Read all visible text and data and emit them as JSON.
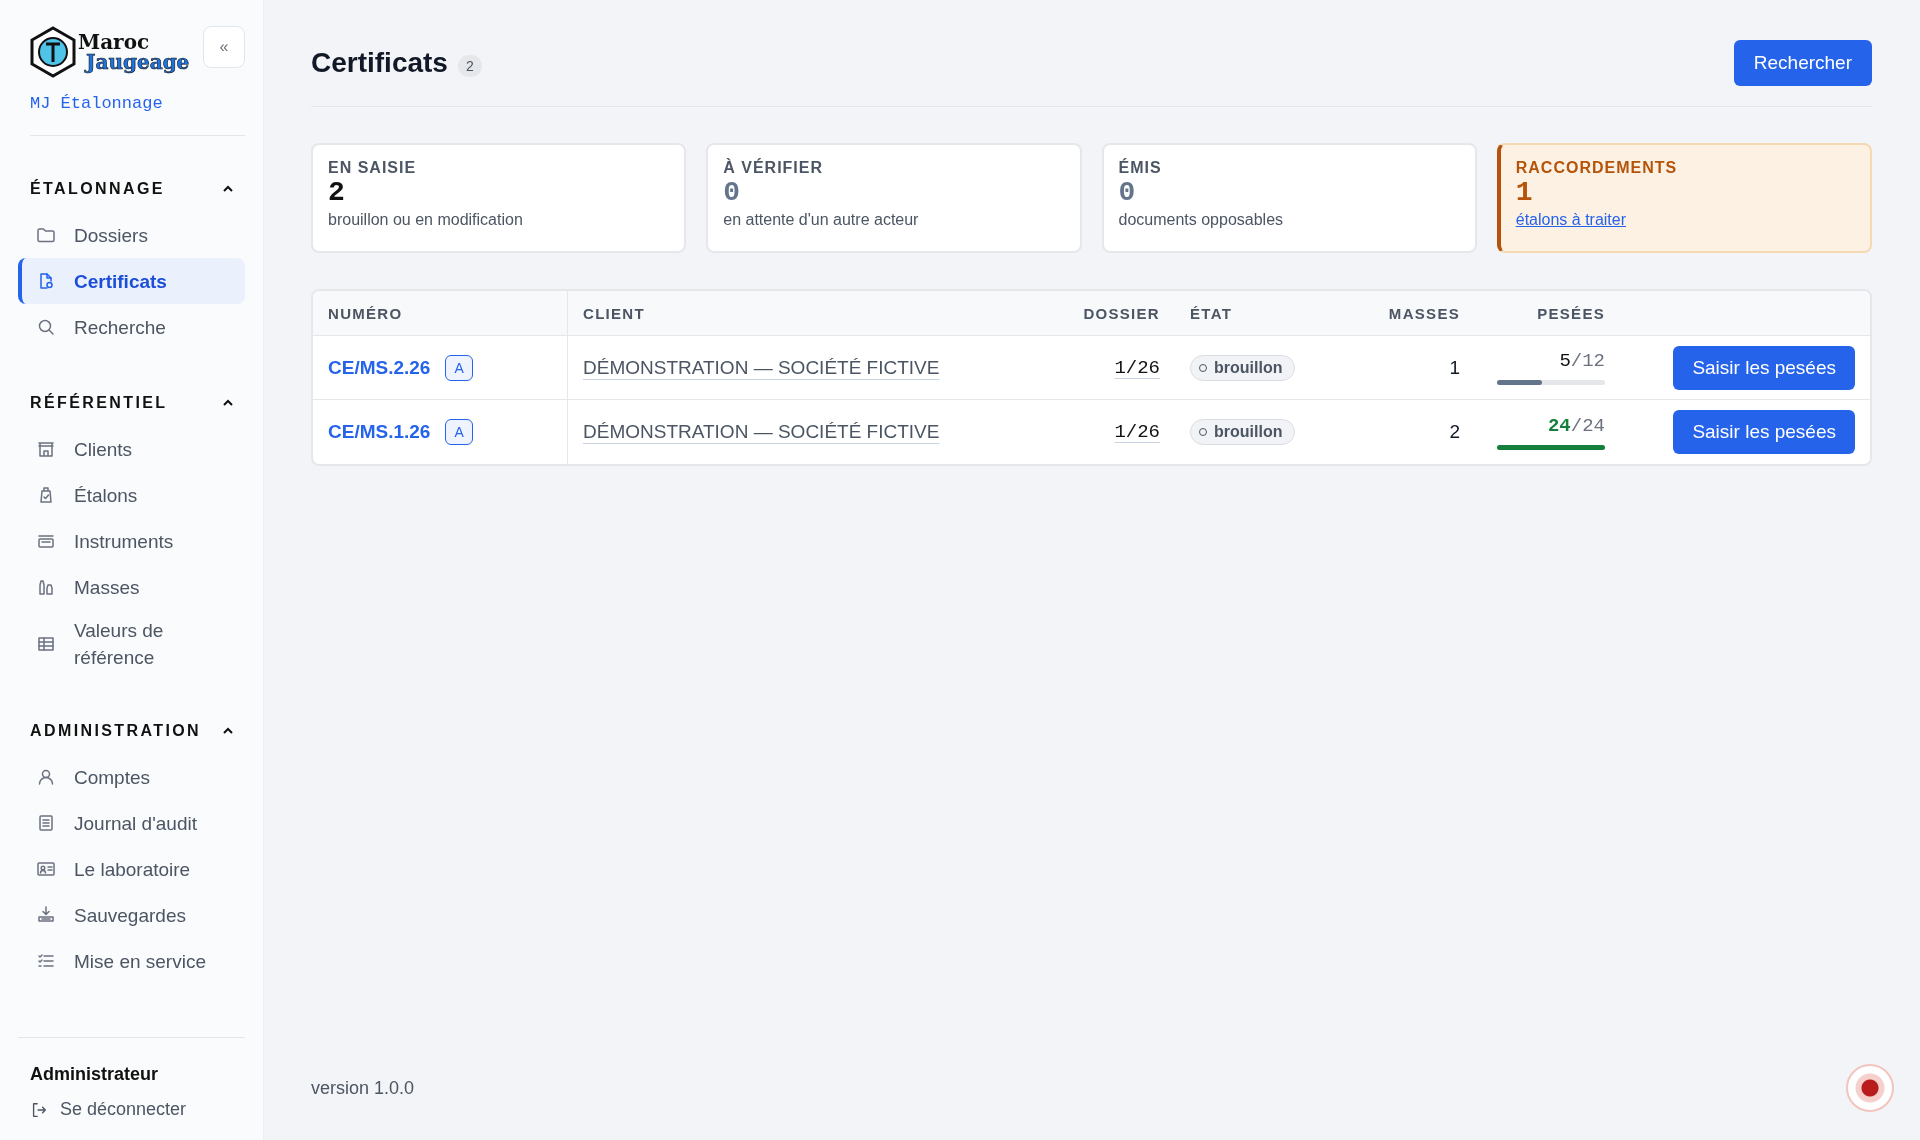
{
  "sidebar": {
    "logo_words": [
      "Maroc",
      "Jaugeage"
    ],
    "app_name": "MJ Étalonnage",
    "collapse_button": "«",
    "sections": [
      {
        "title": "ÉTALONNAGE",
        "expanded": true,
        "items": [
          {
            "label": "Dossiers",
            "kind": "folder",
            "selected": false
          },
          {
            "label": "Certificats",
            "kind": "certificate",
            "selected": true
          },
          {
            "label": "Recherche",
            "kind": "search",
            "selected": false
          }
        ]
      },
      {
        "title": "RÉFÉRENTIEL",
        "expanded": true,
        "items": [
          {
            "label": "Clients",
            "kind": "building",
            "selected": false
          },
          {
            "label": "Étalons",
            "kind": "weight",
            "selected": false
          },
          {
            "label": "Instruments",
            "kind": "scale",
            "selected": false
          },
          {
            "label": "Masses",
            "kind": "masses",
            "selected": false
          },
          {
            "label": "Valeurs de référence",
            "kind": "table",
            "selected": false
          }
        ]
      },
      {
        "title": "ADMINISTRATION",
        "expanded": true,
        "items": [
          {
            "label": "Comptes",
            "kind": "user",
            "selected": false
          },
          {
            "label": "Journal d'audit",
            "kind": "journal",
            "selected": false
          },
          {
            "label": "Le laboratoire",
            "kind": "idcard",
            "selected": false
          },
          {
            "label": "Sauvegardes",
            "kind": "download",
            "selected": false
          },
          {
            "label": "Mise en service",
            "kind": "checklist",
            "selected": false
          }
        ]
      }
    ],
    "user": {
      "name": "Administrateur",
      "logout": "Se déconnecter"
    }
  },
  "header": {
    "title": "Certificats",
    "count": "2",
    "search_button": "Rechercher"
  },
  "stats": [
    {
      "label": "EN SAISIE",
      "value": "2",
      "caption": "brouillon ou en modification",
      "muted": false,
      "highlighted": false
    },
    {
      "label": "À VÉRIFIER",
      "value": "0",
      "caption": "en attente d'un autre acteur",
      "muted": true,
      "highlighted": false
    },
    {
      "label": "ÉMIS",
      "value": "0",
      "caption": "documents opposables",
      "muted": true,
      "highlighted": false
    },
    {
      "label": "RACCORDEMENTS",
      "value": "1",
      "link": "étalons à traiter",
      "muted": false,
      "highlighted": true
    }
  ],
  "table": {
    "columns": [
      "NUMÉRO",
      "CLIENT",
      "DOSSIER",
      "ÉTAT",
      "MASSES",
      "PESÉES"
    ],
    "rows": [
      {
        "numero": "CE/MS.2.26",
        "badge": "A",
        "client": "DÉMONSTRATION — SOCIÉTÉ FICTIVE",
        "dossier": "1/26",
        "etat": "brouillon",
        "masses": "1",
        "pesees_done": "5",
        "pesees_total": "/12",
        "level": 0.42,
        "complete": false,
        "action": "Saisir les pesées"
      },
      {
        "numero": "CE/MS.1.26",
        "badge": "A",
        "client": "DÉMONSTRATION — SOCIÉTÉ FICTIVE",
        "dossier": "1/26",
        "etat": "brouillon",
        "masses": "2",
        "pesees_done": "24",
        "pesees_total": "/24",
        "level": 1,
        "complete": true,
        "action": "Saisir les pesées"
      }
    ]
  },
  "version": "version 1.0.0"
}
